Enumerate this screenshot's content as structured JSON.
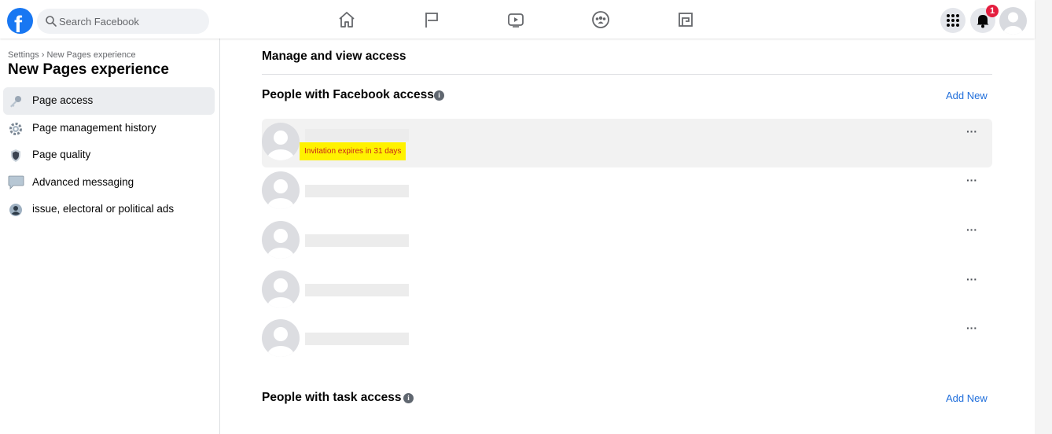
{
  "topbar": {
    "logo_letter": "f",
    "search_placeholder": "Search Facebook",
    "nav_icons": [
      "home-icon",
      "flag-icon",
      "watch-icon",
      "groups-icon",
      "gaming-icon"
    ],
    "notification_count": "1"
  },
  "sidebar": {
    "breadcrumb": "Settings › New Pages experience",
    "title": "New Pages experience",
    "items": [
      {
        "label": "Page access",
        "icon": "key-icon",
        "active": true
      },
      {
        "label": "Page management history",
        "icon": "gear-icon",
        "active": false
      },
      {
        "label": "Page quality",
        "icon": "shield-icon",
        "active": false
      },
      {
        "label": "Advanced messaging",
        "icon": "speech-bubble-icon",
        "active": false
      },
      {
        "label": "issue, electoral or political ads",
        "icon": "person-icon",
        "active": false
      }
    ]
  },
  "main": {
    "heading": "Manage and view access",
    "facebook_access": {
      "title": "People with Facebook access",
      "add_label": "Add New",
      "people": [
        {
          "hint": "Invitation expires in 31 days",
          "highlighted": true
        },
        {
          "hint": "",
          "highlighted": false
        },
        {
          "hint": "",
          "highlighted": false
        },
        {
          "hint": "",
          "highlighted": false
        },
        {
          "hint": "",
          "highlighted": false
        }
      ],
      "more_label": "···"
    },
    "task_access": {
      "title": "People with task access",
      "add_label": "Add New"
    },
    "info_glyph": "i"
  },
  "colors": {
    "brand": "#1877f2",
    "link": "#216fdb",
    "highlight": "#fff200",
    "badge": "#e41e3f"
  }
}
